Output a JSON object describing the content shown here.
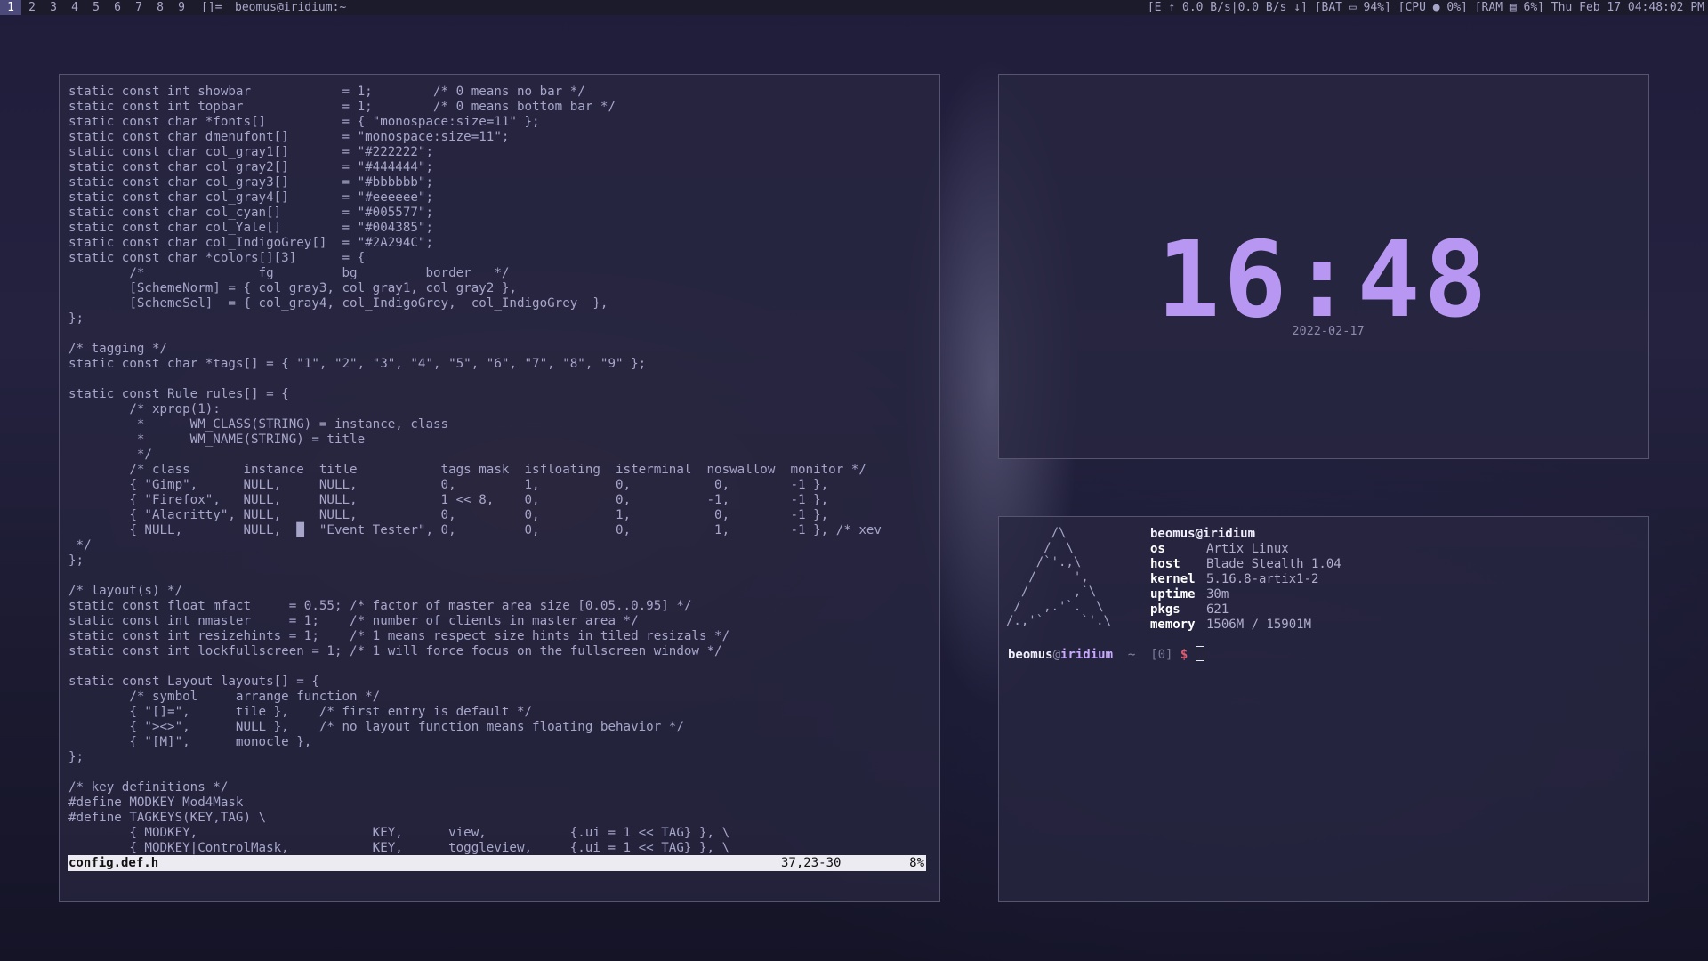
{
  "bar": {
    "tags": [
      "1",
      "2",
      "3",
      "4",
      "5",
      "6",
      "7",
      "8",
      "9"
    ],
    "selected_tag_index": 0,
    "layout": "[]=",
    "window_title": "beomus@iridium:~",
    "status": "[E ↑ 0.0 B/s|0.0 B/s ↓] [BAT ▭ 94%] [CPU ● 0%] [RAM ▤ 6%] Thu Feb 17 04:48:02 PM"
  },
  "editor": {
    "lines": [
      "static const int showbar            = 1;        /* 0 means no bar */",
      "static const int topbar             = 1;        /* 0 means bottom bar */",
      "static const char *fonts[]          = { \"monospace:size=11\" };",
      "static const char dmenufont[]       = \"monospace:size=11\";",
      "static const char col_gray1[]       = \"#222222\";",
      "static const char col_gray2[]       = \"#444444\";",
      "static const char col_gray3[]       = \"#bbbbbb\";",
      "static const char col_gray4[]       = \"#eeeeee\";",
      "static const char col_cyan[]        = \"#005577\";",
      "static const char col_Yale[]        = \"#004385\";",
      "static const char col_IndigoGrey[]  = \"#2A294C\";",
      "static const char *colors[][3]      = {",
      "        /*               fg         bg         border   */",
      "        [SchemeNorm] = { col_gray3, col_gray1, col_gray2 },",
      "        [SchemeSel]  = { col_gray4, col_IndigoGrey,  col_IndigoGrey  },",
      "};",
      "",
      "/* tagging */",
      "static const char *tags[] = { \"1\", \"2\", \"3\", \"4\", \"5\", \"6\", \"7\", \"8\", \"9\" };",
      "",
      "static const Rule rules[] = {",
      "        /* xprop(1):",
      "         *      WM_CLASS(STRING) = instance, class",
      "         *      WM_NAME(STRING) = title",
      "         */",
      "        /* class       instance  title           tags mask  isfloating  isterminal  noswallow  monitor */",
      "        { \"Gimp\",      NULL,     NULL,           0,         1,          0,           0,        -1 },",
      "        { \"Firefox\",   NULL,     NULL,           1 << 8,    0,          0,          -1,        -1 },",
      "        { \"Alacritty\", NULL,     NULL,           0,         0,          1,           0,        -1 },",
      "        { NULL,        NULL,  █  \"Event Tester\", 0,         0,          0,           1,        -1 }, /* xev",
      " */",
      "};",
      "",
      "/* layout(s) */",
      "static const float mfact     = 0.55; /* factor of master area size [0.05..0.95] */",
      "static const int nmaster     = 1;    /* number of clients in master area */",
      "static const int resizehints = 1;    /* 1 means respect size hints in tiled resizals */",
      "static const int lockfullscreen = 1; /* 1 will force focus on the fullscreen window */",
      "",
      "static const Layout layouts[] = {",
      "        /* symbol     arrange function */",
      "        { \"[]=\",      tile },    /* first entry is default */",
      "        { \"><>\",      NULL },    /* no layout function means floating behavior */",
      "        { \"[M]\",      monocle },",
      "};",
      "",
      "/* key definitions */",
      "#define MODKEY Mod4Mask",
      "#define TAGKEYS(KEY,TAG) \\",
      "        { MODKEY,                       KEY,      view,           {.ui = 1 << TAG} }, \\",
      "        { MODKEY|ControlMask,           KEY,      toggleview,     {.ui = 1 << TAG} }, \\"
    ],
    "status_file": "config.def.h",
    "status_pos": "37,23-30",
    "status_pct": "8%"
  },
  "clock": {
    "time": "16:48",
    "date": "2022-02-17",
    "color": "#b897f2"
  },
  "fetch": {
    "logo": [
      "      /\\",
      "     /  \\",
      "    /`'.,\\",
      "   /     ',",
      "  /      ,`\\",
      " /   ,.'`.  \\",
      "/.,'`     `'.\\"
    ],
    "user_host": "beomus@iridium",
    "rows": [
      {
        "k": "os",
        "v": "Artix Linux"
      },
      {
        "k": "host",
        "v": "Blade Stealth 1.04"
      },
      {
        "k": "kernel",
        "v": "5.16.8-artix1-2"
      },
      {
        "k": "uptime",
        "v": "30m"
      },
      {
        "k": "pkgs",
        "v": "621"
      },
      {
        "k": "memory",
        "v": "1506M / 15901M"
      }
    ]
  },
  "prompt": {
    "user": "beomus",
    "at": "@",
    "host": "iridium",
    "dir": "~",
    "status": "[0]",
    "symbol": "$"
  }
}
